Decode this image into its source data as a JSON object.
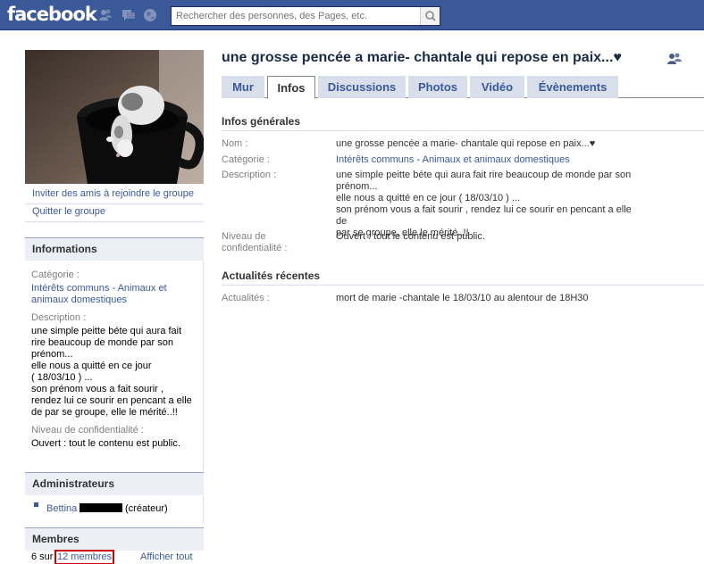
{
  "header": {
    "logo": "facebook",
    "search_placeholder": "Rechercher des personnes, des Pages, etc."
  },
  "sidebar": {
    "invite_link": "Inviter des amis à rejoindre le groupe",
    "leave_link": "Quitter le groupe",
    "info_box": {
      "title": "Informations",
      "category_label": "Catégorie :",
      "category_value": "Intérêts communs - Animaux et animaux domestiques",
      "description_label": "Description :",
      "description_lines": [
        "une simple peitte béte qui aura fait",
        "rire beaucoup de monde par son",
        "prénom...",
        "elle nous a quitté en ce jour",
        "( 18/03/10 ) ...",
        "son prénom vous a fait sourir ,",
        "rendez lui ce sourir en pencant a elle",
        "de par se groupe, elle le mérité..!!"
      ],
      "privacy_label": "Niveau de confidentialité :",
      "privacy_value": "Ouvert : tout le contenu est public."
    },
    "admins": {
      "title": "Administrateurs",
      "admin_name": "Bettina",
      "admin_role": "(créateur)"
    },
    "members": {
      "title": "Membres",
      "count_prefix": "6 sur",
      "count_link": "12 membres",
      "show_all": "Afficher tout"
    }
  },
  "main": {
    "title": "une grosse pencée a marie- chantale qui repose en paix...♥",
    "tabs": [
      {
        "label": "Mur"
      },
      {
        "label": "Infos"
      },
      {
        "label": "Discussions"
      },
      {
        "label": "Photos"
      },
      {
        "label": "Vidéo"
      },
      {
        "label": "Évènements"
      }
    ],
    "active_tab": "Infos",
    "general_info": {
      "title": "Infos générales",
      "name_label": "Nom :",
      "name_value": "une grosse pencée a marie- chantale qui repose en paix...♥",
      "category_label": "Catégorie :",
      "category_part1": "Intérêts communs",
      "category_sep": "-",
      "category_part2": "Animaux et animaux domestiques",
      "description_label": "Description :",
      "description_lines": [
        "une simple peitte béte qui aura fait rire beaucoup de monde par son",
        "prénom...",
        "elle nous a quitté en ce jour ( 18/03/10 ) ...",
        "son prénom vous a fait sourir , rendez lui ce sourir en pencant a elle de",
        "par se groupe, elle le mérité..!!"
      ],
      "privacy_label_lines": [
        "Niveau de",
        "confidentialité :"
      ],
      "privacy_value": "Ouvert : tout le contenu est public."
    },
    "recent_news": {
      "title": "Actualités récentes",
      "news_label": "Actualités :",
      "news_value": "mort de marie -chantale le 18/03/10 au alentour de 18H30"
    }
  }
}
